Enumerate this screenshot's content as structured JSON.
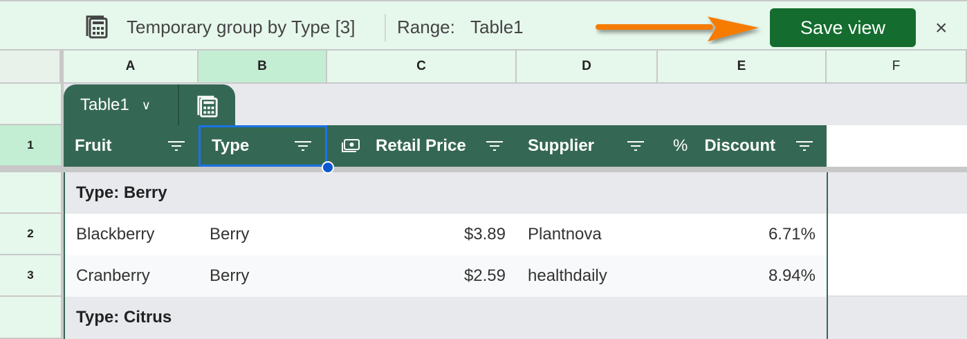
{
  "toolbar": {
    "group_label": "Temporary group by Type [3]",
    "range_label": "Range:",
    "range_value": "Table1",
    "save_label": "Save view",
    "close_label": "×"
  },
  "columns": [
    "A",
    "B",
    "C",
    "D",
    "E",
    "F"
  ],
  "rows": [
    "1",
    "2",
    "3"
  ],
  "table": {
    "name": "Table1",
    "headers": [
      "Fruit",
      "Type",
      "Retail Price",
      "Supplier",
      "Discount"
    ],
    "groups": [
      {
        "label": "Type: Berry",
        "rows": [
          {
            "fruit": "Blackberry",
            "type": "Berry",
            "price": "$3.89",
            "supplier": "Plantnova",
            "discount": "6.71%"
          },
          {
            "fruit": "Cranberry",
            "type": "Berry",
            "price": "$2.59",
            "supplier": "healthdaily",
            "discount": "8.94%"
          }
        ]
      },
      {
        "label": "Type: Citrus",
        "rows": []
      }
    ]
  },
  "icons": {
    "pct": "%"
  },
  "colors": {
    "header": "#356854",
    "save": "#146c2e",
    "selection": "#1a73e8",
    "arrow": "#f57c00"
  }
}
